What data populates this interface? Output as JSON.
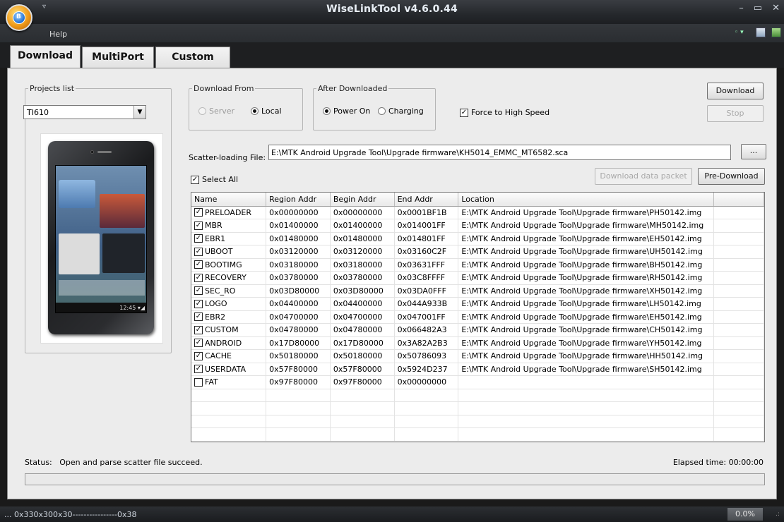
{
  "window": {
    "title": "WiseLinkTool v4.6.0.44",
    "qat_glyph": "▿",
    "min": "–",
    "max": "▭",
    "close": "✕",
    "orb_letter": "B"
  },
  "menu": {
    "help": "Help",
    "style_glyph": "◦ ▾",
    "help_glyph": "?"
  },
  "tabs": [
    {
      "label": "Download",
      "active": true
    },
    {
      "label": "MultiPort",
      "active": false
    },
    {
      "label": "Custom",
      "active": false
    }
  ],
  "projects": {
    "legend": "Projects list",
    "selected": "TI610",
    "dropdown_glyph": "▼",
    "device_clock": "12:45 ▾◢"
  },
  "download_from": {
    "legend": "Download From",
    "server": "Server",
    "local": "Local",
    "selected": "Local"
  },
  "after_downloaded": {
    "legend": "After Downloaded",
    "power_on": "Power On",
    "charging": "Charging",
    "selected": "Power On"
  },
  "force_high_speed": {
    "label": "Force to High Speed",
    "checked": true,
    "check_glyph": "✓"
  },
  "buttons": {
    "download": "Download",
    "stop": "Stop",
    "browse": "...",
    "download_data_packet": "Download data packet",
    "pre_download": "Pre-Download"
  },
  "scatter": {
    "label": "Scatter-loading File:",
    "value": "E:\\MTK Android Upgrade Tool\\Upgrade firmware\\KH5014_EMMC_MT6582.sca"
  },
  "select_all": {
    "label": "Select All",
    "checked": true,
    "check_glyph": "✓"
  },
  "partitions": {
    "columns": [
      "Name",
      "Region Addr",
      "Begin Addr",
      "End Addr",
      "Location"
    ],
    "rows": [
      {
        "checked": true,
        "name": "PRELOADER",
        "region": "0x00000000",
        "begin": "0x00000000",
        "end": "0x0001BF1B",
        "location": "E:\\MTK Android Upgrade Tool\\Upgrade firmware\\PH50142.img"
      },
      {
        "checked": true,
        "name": "MBR",
        "region": "0x01400000",
        "begin": "0x01400000",
        "end": "0x014001FF",
        "location": "E:\\MTK Android Upgrade Tool\\Upgrade firmware\\MH50142.img"
      },
      {
        "checked": true,
        "name": "EBR1",
        "region": "0x01480000",
        "begin": "0x01480000",
        "end": "0x014801FF",
        "location": "E:\\MTK Android Upgrade Tool\\Upgrade firmware\\EH50142.img"
      },
      {
        "checked": true,
        "name": "UBOOT",
        "region": "0x03120000",
        "begin": "0x03120000",
        "end": "0x03160C2F",
        "location": "E:\\MTK Android Upgrade Tool\\Upgrade firmware\\UH50142.img"
      },
      {
        "checked": true,
        "name": "BOOTIMG",
        "region": "0x03180000",
        "begin": "0x03180000",
        "end": "0x03631FFF",
        "location": "E:\\MTK Android Upgrade Tool\\Upgrade firmware\\BH50142.img"
      },
      {
        "checked": true,
        "name": "RECOVERY",
        "region": "0x03780000",
        "begin": "0x03780000",
        "end": "0x03C8FFFF",
        "location": "E:\\MTK Android Upgrade Tool\\Upgrade firmware\\RH50142.img"
      },
      {
        "checked": true,
        "name": "SEC_RO",
        "region": "0x03D80000",
        "begin": "0x03D80000",
        "end": "0x03DA0FFF",
        "location": "E:\\MTK Android Upgrade Tool\\Upgrade firmware\\XH50142.img"
      },
      {
        "checked": true,
        "name": "LOGO",
        "region": "0x04400000",
        "begin": "0x04400000",
        "end": "0x044A933B",
        "location": "E:\\MTK Android Upgrade Tool\\Upgrade firmware\\LH50142.img"
      },
      {
        "checked": true,
        "name": "EBR2",
        "region": "0x04700000",
        "begin": "0x04700000",
        "end": "0x047001FF",
        "location": "E:\\MTK Android Upgrade Tool\\Upgrade firmware\\EH50142.img"
      },
      {
        "checked": true,
        "name": "CUSTOM",
        "region": "0x04780000",
        "begin": "0x04780000",
        "end": "0x066482A3",
        "location": "E:\\MTK Android Upgrade Tool\\Upgrade firmware\\CH50142.img"
      },
      {
        "checked": true,
        "name": "ANDROID",
        "region": "0x17D80000",
        "begin": "0x17D80000",
        "end": "0x3A82A2B3",
        "location": "E:\\MTK Android Upgrade Tool\\Upgrade firmware\\YH50142.img"
      },
      {
        "checked": true,
        "name": "CACHE",
        "region": "0x50180000",
        "begin": "0x50180000",
        "end": "0x50786093",
        "location": "E:\\MTK Android Upgrade Tool\\Upgrade firmware\\HH50142.img"
      },
      {
        "checked": true,
        "name": "USERDATA",
        "region": "0x57F80000",
        "begin": "0x57F80000",
        "end": "0x5924D237",
        "location": "E:\\MTK Android Upgrade Tool\\Upgrade firmware\\SH50142.img"
      },
      {
        "checked": false,
        "name": "FAT",
        "region": "0x97F80000",
        "begin": "0x97F80000",
        "end": "0x00000000",
        "location": ""
      }
    ],
    "check_glyph": "✓"
  },
  "status": {
    "label": "Status:",
    "text": "Open and parse scatter file succeed.",
    "elapsed": "Elapsed time: 00:00:00",
    "progress": 0
  },
  "statusbar": {
    "text": "... 0x330x300x30----------------0x38",
    "percent": "0.0%",
    "grip": ".:"
  }
}
